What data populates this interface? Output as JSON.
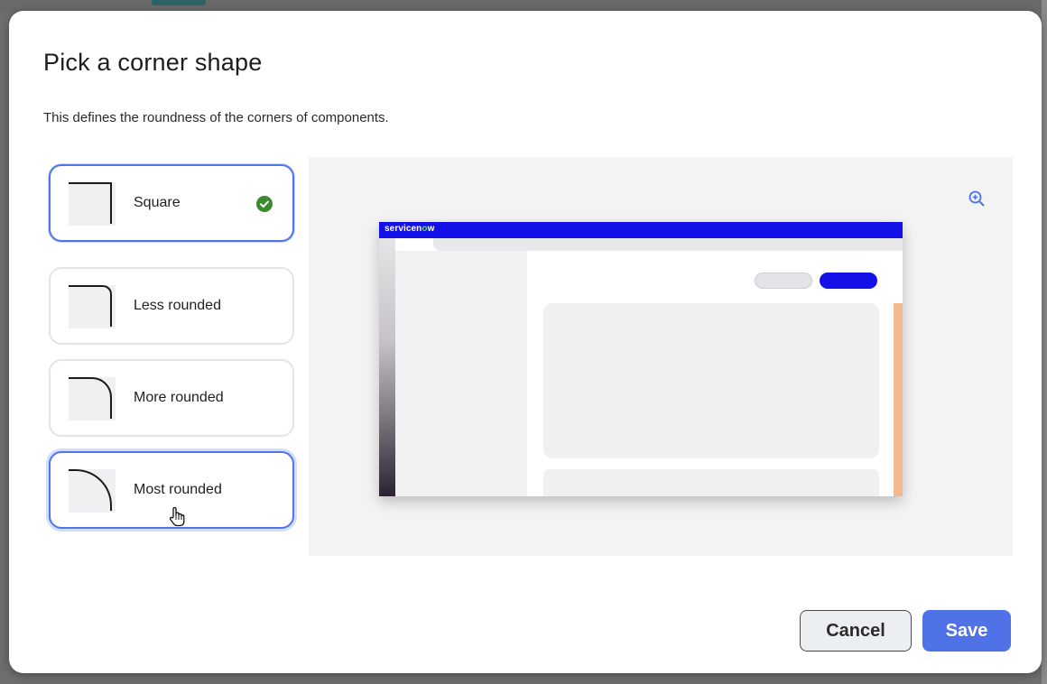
{
  "dialog": {
    "title": "Pick a corner shape",
    "description": "This defines the roundness of the corners of components."
  },
  "options": [
    {
      "label": "Square",
      "selected": true
    },
    {
      "label": "Less rounded",
      "selected": false
    },
    {
      "label": "More rounded",
      "selected": false
    },
    {
      "label": "Most rounded",
      "selected": false,
      "hovered": true
    }
  ],
  "preview": {
    "brand_text_part1": "servicen",
    "brand_text_accent": "o",
    "brand_text_part2": "w",
    "zoom_icon": "zoom-in-icon"
  },
  "footer": {
    "cancel_label": "Cancel",
    "save_label": "Save"
  },
  "colors": {
    "primary": "#4f72e6",
    "selected_border": "#4f76e8",
    "success": "#3c8a2e",
    "mock_brand": "#1411e8",
    "mock_accent": "#f3b98e"
  },
  "icons": [
    "check-circle-icon",
    "pointer-hand-cursor-icon",
    "zoom-in-icon"
  ]
}
